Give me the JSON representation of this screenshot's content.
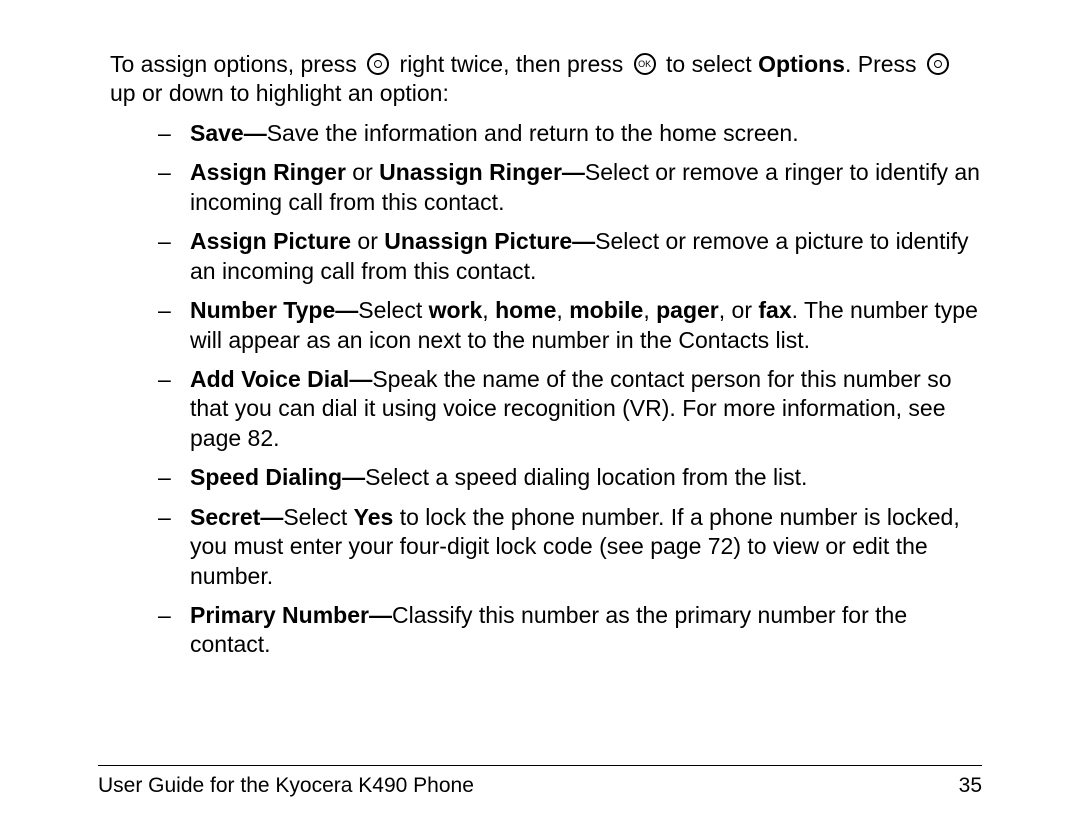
{
  "intro": {
    "segA": "To assign options, press ",
    "segB": " right twice, then press ",
    "segC": " to select ",
    "bold_options": "Options",
    "period": ". ",
    "segD": "Press ",
    "segE": " up or down to highlight an option:",
    "ok_label": "OK"
  },
  "items": [
    {
      "leadBold": "Save—",
      "tail": "Save the information and return to the home screen."
    },
    {
      "b1": "Assign Ringer",
      "t1": " or ",
      "b2": "Unassign Ringer—",
      "tail": "Select or remove a ringer to identify an incoming call from this contact."
    },
    {
      "b1": "Assign Picture",
      "t1": " or ",
      "b2": "Unassign Picture—",
      "tail": "Select or remove a picture to identify an incoming call from this contact."
    },
    {
      "b1": "Number Type—",
      "t1": "Select ",
      "bw1": "work",
      "c1": ", ",
      "bw2": "home",
      "c2": ", ",
      "bw3": "mobile",
      "c3": ", ",
      "bw4": "pager",
      "c4": ", or ",
      "bw5": "fax",
      "tail": ". The number type will appear as an icon next to the number in the Contacts list."
    },
    {
      "leadBold": "Add Voice Dial—",
      "tail": "Speak the name of the contact person for this number so that you can dial it using voice recognition (VR). For more information, see page 82."
    },
    {
      "leadBold": "Speed Dialing—",
      "tail": "Select a speed dialing location from the list."
    },
    {
      "leadBold": "Secret—",
      "t1": "Select ",
      "byes": "Yes",
      "tail": " to lock the phone number. If a phone number is locked, you must enter your four-digit lock code (see page 72) to view or edit the number."
    },
    {
      "leadBold": "Primary Number—",
      "tail": "Classify this number as the primary number for the contact."
    }
  ],
  "footer": {
    "left": "User Guide for the Kyocera K490 Phone",
    "right": "35"
  }
}
